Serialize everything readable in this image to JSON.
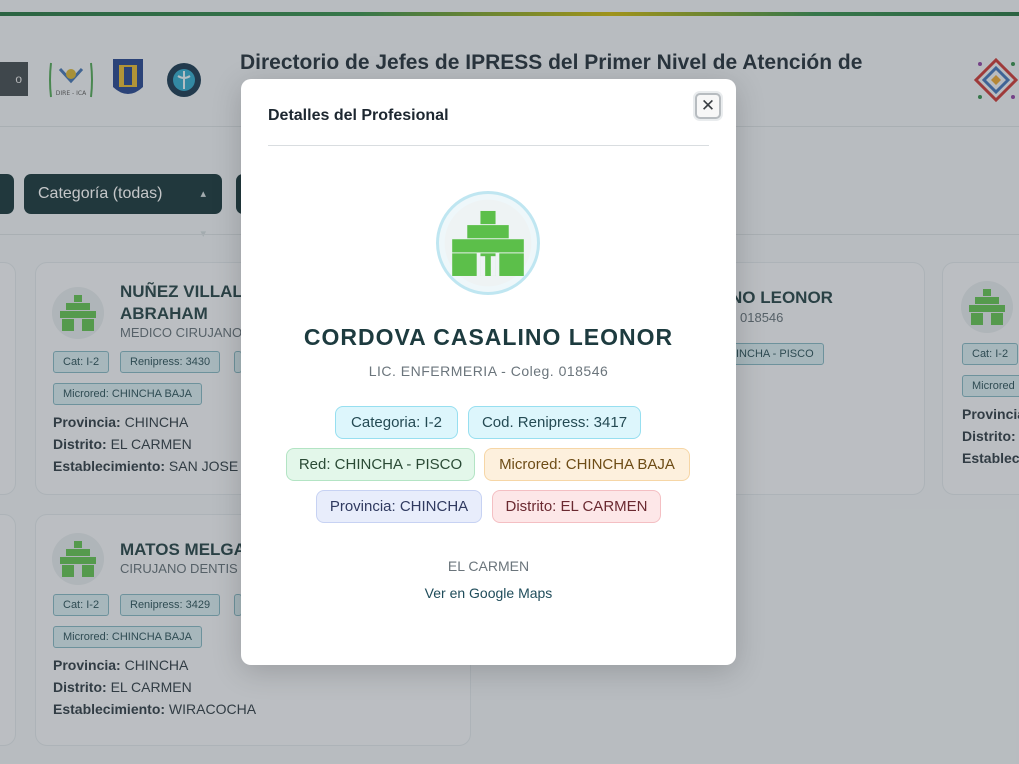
{
  "header": {
    "title": "Directorio de Jefes de IPRESS del Primer Nivel de Atención de",
    "left_button_label": "o",
    "logos": [
      "diresa-ica-logo",
      "shield-logo",
      "health-seal-logo",
      "regional-emblem-logo"
    ],
    "logo1_text": "DIRE - ICA"
  },
  "filters": {
    "category_label": "Categoría (todas)"
  },
  "colors": {
    "accent_dark": "#0f2f33",
    "brand_green": "#5cbf4a",
    "stripe_green": "#2f8a46",
    "stripe_yellow": "#c9b400"
  },
  "cards": [
    {
      "name_line1": "NUÑEZ VILLAL",
      "name_line2": "ABRAHAM",
      "profession": "MEDICO CIRUJANO",
      "cat_chip": "Cat: I-2",
      "renipress_chip": "Renipress: 3430",
      "microred_chip": "Microred: CHINCHA BAJA",
      "provincia_label": "Provincia:",
      "provincia": "CHINCHA",
      "distrito_label": "Distrito:",
      "distrito": "EL CARMEN",
      "establecimiento_label": "Establecimiento:",
      "establecimiento": "SAN JOSE"
    },
    {
      "name_line1": "MATOS MELGA",
      "profession": "CIRUJANO DENTIS",
      "cat_chip": "Cat: I-2",
      "renipress_chip": "Renipress: 3429",
      "microred_chip": "Microred: CHINCHA BAJA",
      "provincia_label": "Provincia:",
      "provincia": "CHINCHA",
      "distrito_label": "Distrito:",
      "distrito": "EL CARMEN",
      "establecimiento_label": "Establecimiento:",
      "establecimiento": "WIRACOCHA"
    },
    {
      "name_line1": "NO LEONOR",
      "profession": "018546",
      "red_chip": "INCHA - PISCO"
    },
    {
      "cat_chip": "Cat: I-2",
      "microred_chip": "Microred",
      "provincia_label": "Provincia",
      "distrito_label": "Distrito:",
      "establecimiento_label": "Estableci"
    }
  ],
  "modal": {
    "title": "Detalles del Profesional",
    "close_label": "✕",
    "name": "CORDOVA CASALINO LEONOR",
    "subtitle": "LIC. ENFERMERIA - Coleg. 018546",
    "categoria": "Categoria: I-2",
    "renipress": "Cod. Renipress: 3417",
    "red": "Red: CHINCHA - PISCO",
    "microred": "Microred: CHINCHA BAJA",
    "provincia": "Provincia: CHINCHA",
    "distrito": "Distrito: EL CARMEN",
    "establecimiento": "EL CARMEN",
    "maps_link": "Ver en Google Maps"
  }
}
